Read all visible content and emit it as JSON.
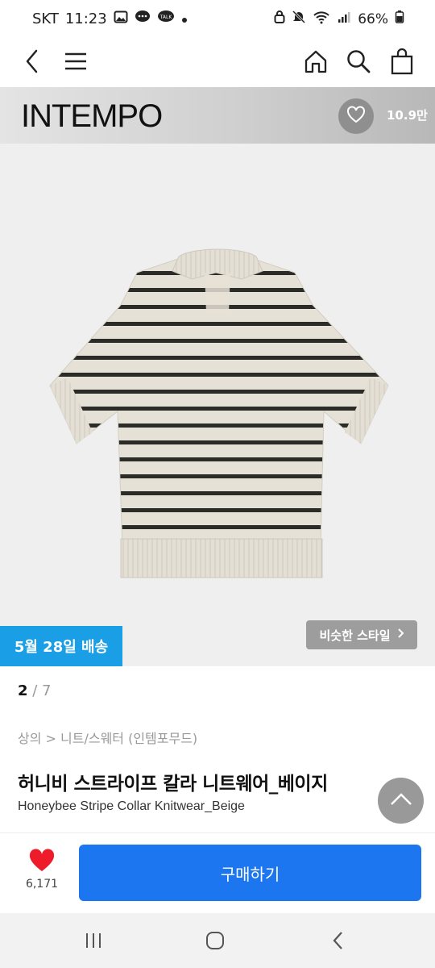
{
  "status_bar": {
    "carrier": "SKT",
    "time": "11:23",
    "battery": "66%",
    "left_icons": [
      "gallery-icon",
      "chat-icon",
      "talk-icon",
      "dot-icon"
    ],
    "right_icons": [
      "lock-icon",
      "mute-icon",
      "wifi-icon",
      "signal-icon",
      "battery-icon"
    ]
  },
  "nav": {
    "icons": [
      "back-icon",
      "menu-icon",
      "home-icon",
      "search-icon",
      "cart-icon"
    ]
  },
  "brand": {
    "name": "INTEMPO",
    "like_count": "10.9만"
  },
  "product": {
    "delivery_badge": "5월 28일 배송",
    "similar_style": "비슷한 스타일",
    "pager": {
      "current": "2",
      "separator": " / ",
      "total": "7"
    },
    "breadcrumb": "상의 > 니트/스웨터 (인템포무드)",
    "title_ko": "허니비 스트라이프 칼라 니트웨어_베이지",
    "title_en": "Honeybee Stripe Collar Knitwear_Beige",
    "image_alt": "striped knit polo shirt",
    "colors": {
      "knit_base": "#e6e1d6",
      "stripe": "#2b2b28"
    }
  },
  "buy_bar": {
    "wish_count": "6,171",
    "buy_label": "구매하기",
    "colors": {
      "heart": "#ee1c2b",
      "buy_button": "#1c76ef"
    }
  },
  "system_nav": {
    "icons": [
      "recents-icon",
      "home-circle-icon",
      "back-arrow-icon"
    ]
  }
}
